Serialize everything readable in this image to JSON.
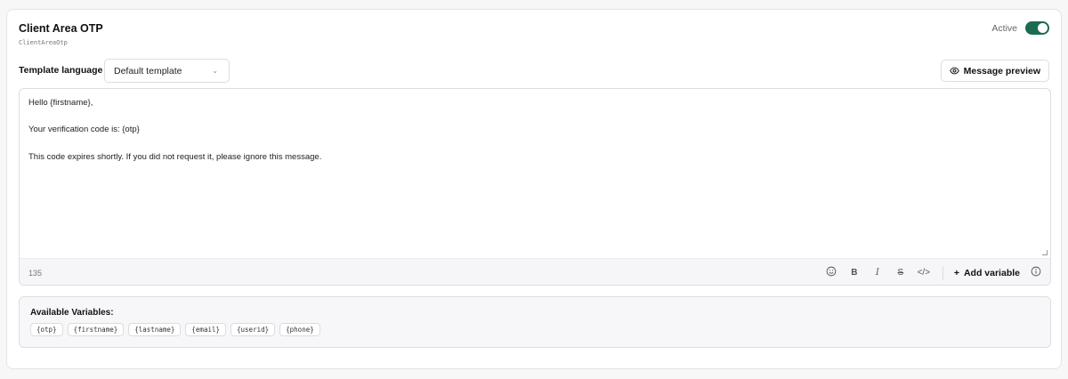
{
  "header": {
    "title": "Client Area OTP",
    "slug": "ClientAreaOtp",
    "active_label": "Active",
    "active": true
  },
  "language": {
    "label": "Template language",
    "selected": "Default template"
  },
  "preview_button": "Message preview",
  "editor": {
    "lines": [
      "Hello {firstname},",
      "",
      "Your verification code is: {otp}",
      "",
      "This code expires shortly. If you did not request it, please ignore this message."
    ],
    "char_count": "135",
    "tools": [
      "emoji-icon",
      "bold",
      "italic",
      "strikethrough",
      "code"
    ],
    "add_variable": "Add variable"
  },
  "variables": {
    "title": "Available Variables:",
    "items": [
      "{otp}",
      "{firstname}",
      "{lastname}",
      "{email}",
      "{userid}",
      "{phone}"
    ]
  },
  "colors": {
    "toggle_on": "#1c6b4e",
    "border": "#dcdde1"
  }
}
